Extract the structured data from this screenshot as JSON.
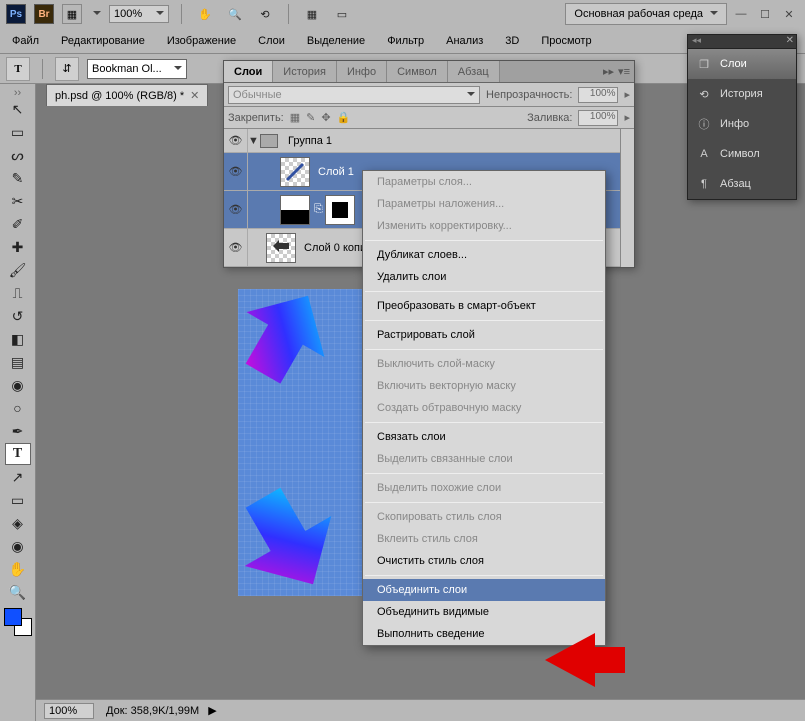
{
  "titlebar": {
    "zoom": "100%",
    "workspace": "Основная рабочая среда"
  },
  "menubar": {
    "items": [
      "Файл",
      "Редактирование",
      "Изображение",
      "Слои",
      "Выделение",
      "Фильтр",
      "Анализ",
      "3D",
      "Просмотр"
    ]
  },
  "optbar": {
    "font": "Bookman Ol..."
  },
  "document": {
    "tab_title": "ph.psd @ 100% (RGB/8) *"
  },
  "statusbar": {
    "zoom": "100%",
    "doc_label": "Док:",
    "doc_value": "358,9K/1,99M"
  },
  "layers_panel": {
    "tabs": [
      "Слои",
      "История",
      "Инфо",
      "Символ",
      "Абзац"
    ],
    "blend_mode": "Обычные",
    "opacity_label": "Непрозрачность:",
    "opacity_value": "100%",
    "lock_label": "Закрепить:",
    "fill_label": "Заливка:",
    "fill_value": "100%",
    "group_name": "Группа 1",
    "layer1_name": "Слой 1",
    "layer0_name": "Слой 0 копи"
  },
  "context_menu": {
    "items": [
      {
        "label": "Параметры слоя...",
        "disabled": true
      },
      {
        "label": "Параметры наложения...",
        "disabled": true
      },
      {
        "label": "Изменить корректировку...",
        "disabled": true
      },
      {
        "sep": true
      },
      {
        "label": "Дубликат слоев...",
        "disabled": false
      },
      {
        "label": "Удалить слои",
        "disabled": false
      },
      {
        "sep": true
      },
      {
        "label": "Преобразовать в смарт-объект",
        "disabled": false
      },
      {
        "sep": true
      },
      {
        "label": "Растрировать слой",
        "disabled": false
      },
      {
        "sep": true
      },
      {
        "label": "Выключить слой-маску",
        "disabled": true
      },
      {
        "label": "Включить векторную маску",
        "disabled": true
      },
      {
        "label": "Создать обтравочную маску",
        "disabled": true
      },
      {
        "sep": true
      },
      {
        "label": "Связать слои",
        "disabled": false
      },
      {
        "label": "Выделить связанные слои",
        "disabled": true
      },
      {
        "sep": true
      },
      {
        "label": "Выделить похожие слои",
        "disabled": true
      },
      {
        "sep": true
      },
      {
        "label": "Скопировать стиль слоя",
        "disabled": true
      },
      {
        "label": "Вклеить стиль слоя",
        "disabled": true
      },
      {
        "label": "Очистить стиль слоя",
        "disabled": false
      },
      {
        "sep": true
      },
      {
        "label": "Объединить слои",
        "disabled": false,
        "highlight": true
      },
      {
        "label": "Объединить видимые",
        "disabled": false
      },
      {
        "label": "Выполнить сведение",
        "disabled": false
      }
    ]
  },
  "flyout": {
    "items": [
      {
        "label": "Слои",
        "icon": "layers",
        "active": true
      },
      {
        "label": "История",
        "icon": "history"
      },
      {
        "label": "Инфо",
        "icon": "info"
      },
      {
        "label": "Символ",
        "icon": "character"
      },
      {
        "label": "Абзац",
        "icon": "paragraph"
      }
    ]
  }
}
